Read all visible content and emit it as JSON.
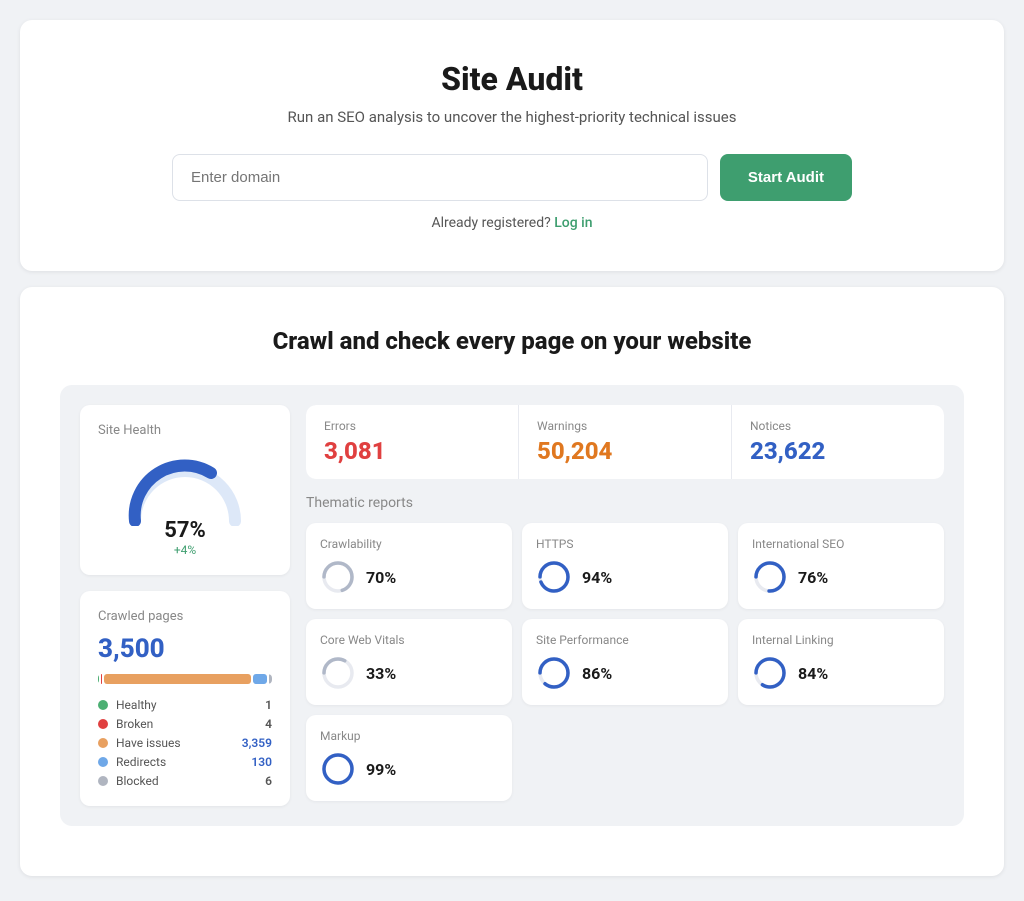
{
  "header": {
    "title": "Site Audit",
    "subtitle": "Run an SEO analysis to uncover the highest-priority technical issues",
    "domain_placeholder": "Enter domain",
    "start_button": "Start Audit",
    "login_prompt": "Already registered?",
    "login_link": "Log in"
  },
  "section": {
    "title": "Crawl and check every page on your website"
  },
  "site_health": {
    "label": "Site Health",
    "percent": "57%",
    "delta": "+4%"
  },
  "crawled_pages": {
    "label": "Crawled pages",
    "count": "3,500",
    "legend": [
      {
        "name": "Healthy",
        "color": "#4caf73",
        "count": "1"
      },
      {
        "name": "Broken",
        "color": "#e04040",
        "count": "4"
      },
      {
        "name": "Have issues",
        "color": "#e8a060",
        "count": "3,359",
        "highlight": true
      },
      {
        "name": "Redirects",
        "color": "#6fa8e8",
        "count": "130",
        "highlight": true
      },
      {
        "name": "Blocked",
        "color": "#b0b5c0",
        "count": "6"
      }
    ],
    "bar": [
      {
        "color": "#4caf73",
        "pct": 0.3
      },
      {
        "color": "#e04040",
        "pct": 1
      },
      {
        "color": "#e8a060",
        "pct": 88
      },
      {
        "color": "#6fa8e8",
        "pct": 8
      },
      {
        "color": "#b0b5c0",
        "pct": 2
      }
    ]
  },
  "stats": [
    {
      "label": "Errors",
      "value": "3,081",
      "type": "error"
    },
    {
      "label": "Warnings",
      "value": "50,204",
      "type": "warning"
    },
    {
      "label": "Notices",
      "value": "23,622",
      "type": "notice"
    }
  ],
  "thematic": {
    "label": "Thematic reports",
    "items": [
      {
        "name": "Crawlability",
        "pct": "70%",
        "value": 70,
        "color": "#b0b8c8"
      },
      {
        "name": "HTTPS",
        "pct": "94%",
        "value": 94,
        "color": "#3260c4"
      },
      {
        "name": "International SEO",
        "pct": "76%",
        "value": 76,
        "color": "#3260c4"
      },
      {
        "name": "Core Web Vitals",
        "pct": "33%",
        "value": 33,
        "color": "#b0b8c8"
      },
      {
        "name": "Site Performance",
        "pct": "86%",
        "value": 86,
        "color": "#3260c4"
      },
      {
        "name": "Internal Linking",
        "pct": "84%",
        "value": 84,
        "color": "#3260c4"
      },
      {
        "name": "Markup",
        "pct": "99%",
        "value": 99,
        "color": "#3260c4"
      }
    ]
  },
  "colors": {
    "accent_green": "#3e9e6f",
    "accent_blue": "#3260c4",
    "error": "#e04040",
    "warning": "#e07820",
    "gauge_blue": "#3260c4",
    "gauge_track": "#dde8f8"
  }
}
